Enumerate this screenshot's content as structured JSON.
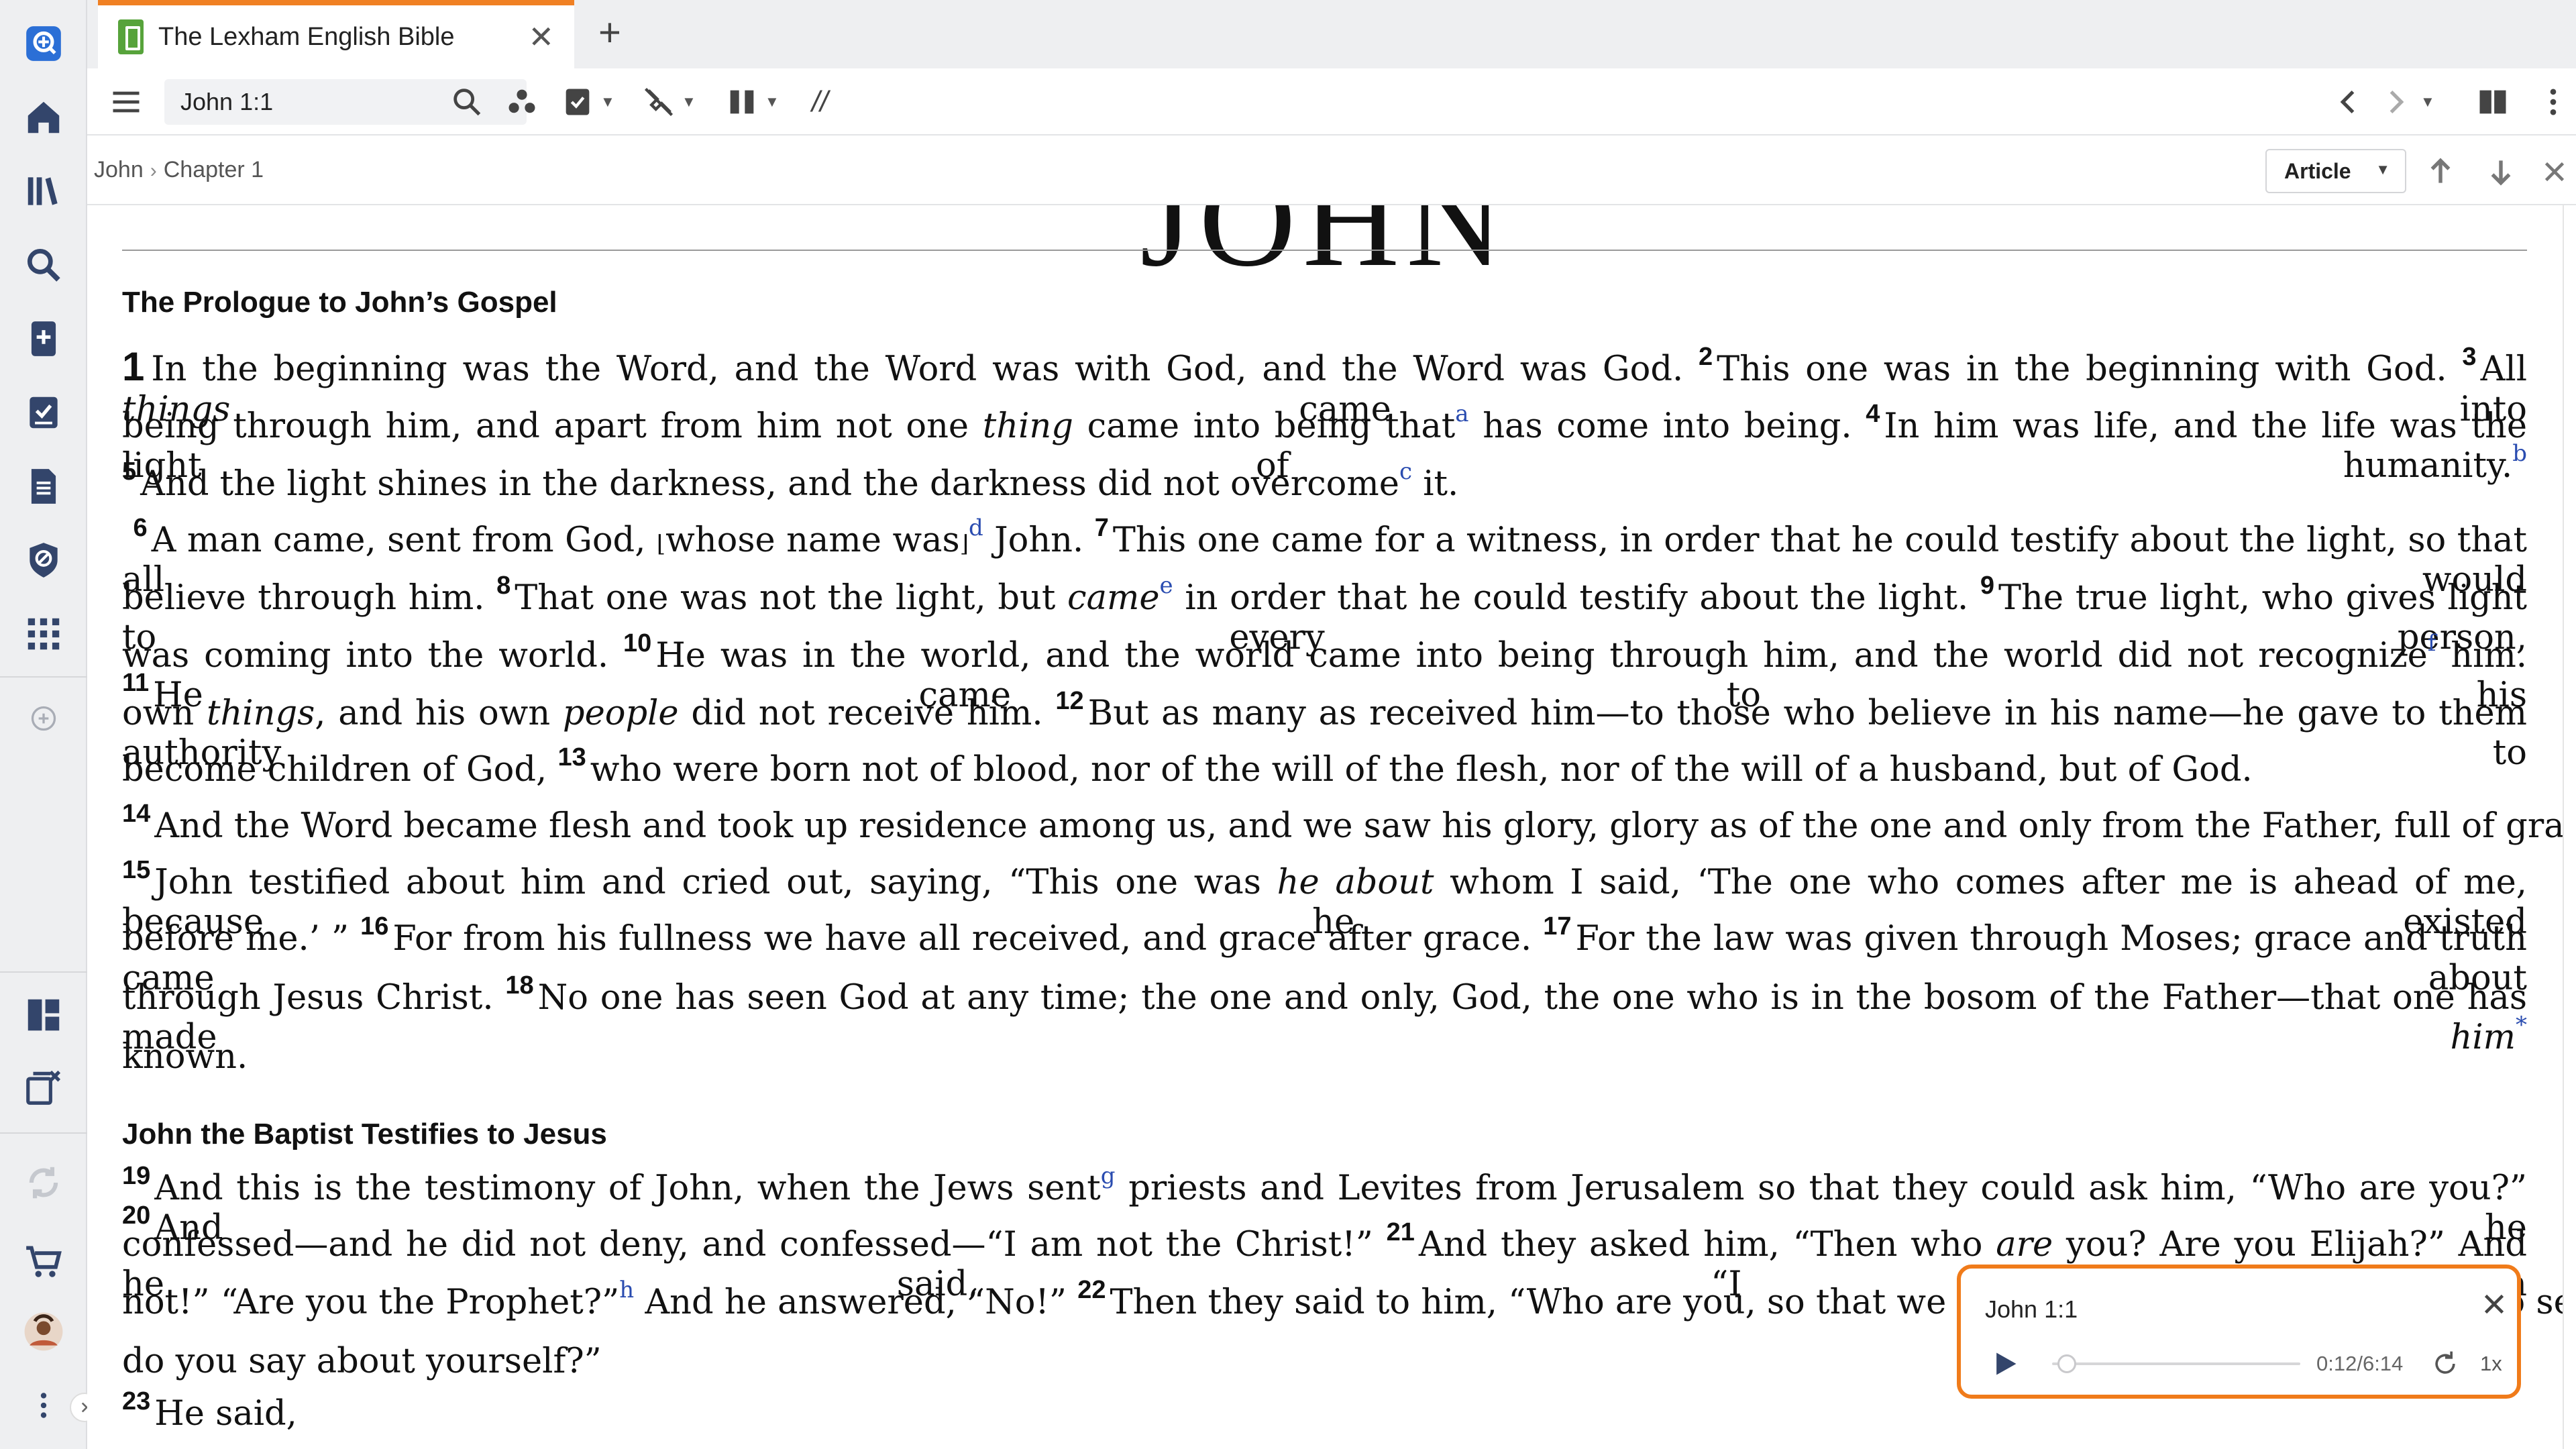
{
  "tab": {
    "title": "The Lexham English Bible",
    "close": "✕",
    "new": "+"
  },
  "toolbar": {
    "reference": "John 1:1",
    "parallel": "//"
  },
  "breadcrumb": {
    "book": "John",
    "sep": "›",
    "chapter": "Chapter 1"
  },
  "article_btn": "Article",
  "book_heading": "JOHN",
  "sections": [
    "The Prologue to John’s Gospel",
    "John the Baptist Testifies to Jesus"
  ],
  "verse_numbers": [
    "1",
    "2",
    "3",
    "4",
    "5",
    "6",
    "7",
    "8",
    "9",
    "10",
    "11",
    "12",
    "13",
    "14",
    "15",
    "16",
    "17",
    "18",
    "19",
    "20",
    "21",
    "22",
    "23"
  ],
  "footnotes": [
    "a",
    "b",
    "c",
    "d",
    "e",
    "f",
    "*",
    "g",
    "h"
  ],
  "text": {
    "t1a": "In the beginning was the Word, and the Word was with God, and the Word was God.",
    "t2": "This one was in the beginning with God.",
    "t3a": "All",
    "t3b": "things",
    "t3c": "came into",
    "t3d": "being through him, and apart from him not one",
    "t3e": "thing",
    "t3f": "came into being that",
    "t3g": "has come into being.",
    "t4": "In him was life, and the life was the light of humanity.",
    "t5a": "And the light shines in the darkness, and the darkness did not overcome",
    "t5b": "it.",
    "t6a": "A man came, sent from God,",
    "t6b": "⌊",
    "t6c": "whose name was",
    "t6d": "⌋",
    "t6e": "John.",
    "t7a": "This one came for a witness, in order that he could testify about the light, so that all would",
    "t7b": "believe through him.",
    "t8a": "That one was not the light, but",
    "t8b": "came",
    "t8c": "in order that he could testify about the light.",
    "t9a": "The true light, who gives light to every person,",
    "t9b": "was coming into the world.",
    "t10a": "He was in the world, and the world came into being through him, and the world did not recognize",
    "t10b": "him.",
    "t11a": "He came to his",
    "t11b": "own",
    "t11c": "things",
    "t11d": ", and his own",
    "t11e": "people",
    "t11f": "did not receive him.",
    "t12a": "But as many as received him—to those who believe in his name—he gave to them authority to",
    "t12b": "become children of God,",
    "t13": "who were born not of blood, nor of the will of the flesh, nor of the will of a husband, but of God.",
    "t14": "And the Word became flesh and took up residence among us, and we saw his glory, glory as of the one and only from the Father, full of grace and truth.",
    "t15a": "John testified about him and cried out, saying, “This one was",
    "t15b": "he about",
    "t15c": "whom I said, ‘The one who comes after me is ahead of me, because he existed",
    "t15d": "before me.’ ”",
    "t16": "For from his fullness we have all received, and grace after grace.",
    "t17a": "For the law was given through Moses; grace and truth came about",
    "t17b": "through Jesus Christ.",
    "t18a": "No one has seen God at any time; the one and only, God, the one who is in the bosom of the Father—that one has made",
    "t18b": "him",
    "t18c": "known.",
    "t19a": "And this is the testimony of John, when the Jews sent",
    "t19b": "priests and Levites from Jerusalem so that they could ask him, “Who are you?”",
    "t20a": "And he",
    "t20b": "confessed—and he did not deny, and confessed—“I am not the Christ!”",
    "t21a": "And they asked him, “Then who",
    "t21b": "are",
    "t21c": "you? Are you Elijah?” And he said, “I am",
    "t21d": "not!” “Are you the Prophet?”",
    "t21e": "And he answered, “No!”",
    "t22a": "Then they said to him, “Who are you, so that we can give an answer to those who sent us? What",
    "t22b": "do you say about yourself?”",
    "t23": "He said,"
  },
  "player": {
    "title": "John 1:1",
    "time": "0:12/6:14",
    "speed": "1x",
    "progress": 0.032
  },
  "colors": {
    "accent": "#f08023",
    "footnote": "#2a4cb0",
    "rail": "#eeeff1",
    "icon": "#33456b"
  },
  "icons": {
    "rail": [
      "logos-search-icon",
      "home-icon",
      "library-icon",
      "search-icon",
      "add-document-icon",
      "checklist-icon",
      "document-icon",
      "shield-icon",
      "apps-grid-icon",
      "add-circle-icon",
      "layouts-icon",
      "close-panels-icon",
      "sync-icon",
      "cart-icon",
      "user-avatar",
      "more-vertical-icon",
      "expand-chevron-icon"
    ]
  }
}
